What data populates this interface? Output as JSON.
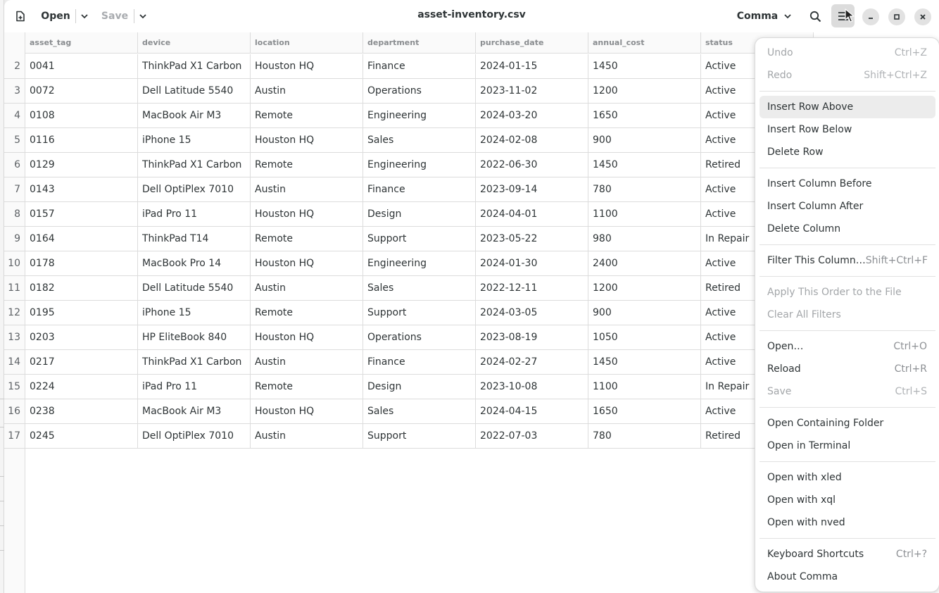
{
  "app": {
    "title": "asset-inventory.csv",
    "open_label": "Open",
    "save_label": "Save",
    "delimiter_label": "Comma"
  },
  "icons": {
    "new": "new-document-icon",
    "search": "search-icon",
    "menu": "hamburger-menu-icon",
    "minimize": "minimize-icon",
    "maximize": "maximize-icon",
    "close": "close-icon"
  },
  "table": {
    "columns": [
      "asset_tag",
      "device",
      "location",
      "department",
      "purchase_date",
      "annual_cost",
      "status"
    ],
    "rows": [
      {
        "num": "2",
        "cells": [
          "0041",
          "ThinkPad X1 Carbon",
          "Houston HQ",
          "Finance",
          "2024-01-15",
          "1450",
          "Active"
        ]
      },
      {
        "num": "3",
        "cells": [
          "0072",
          "Dell Latitude 5540",
          "Austin",
          "Operations",
          "2023-11-02",
          "1200",
          "Active"
        ]
      },
      {
        "num": "4",
        "cells": [
          "0108",
          "MacBook Air M3",
          "Remote",
          "Engineering",
          "2024-03-20",
          "1650",
          "Active"
        ]
      },
      {
        "num": "5",
        "cells": [
          "0116",
          "iPhone 15",
          "Houston HQ",
          "Sales",
          "2024-02-08",
          "900",
          "Active"
        ]
      },
      {
        "num": "6",
        "cells": [
          "0129",
          "ThinkPad X1 Carbon",
          "Remote",
          "Engineering",
          "2022-06-30",
          "1450",
          "Retired"
        ]
      },
      {
        "num": "7",
        "cells": [
          "0143",
          "Dell OptiPlex 7010",
          "Austin",
          "Finance",
          "2023-09-14",
          "780",
          "Active"
        ]
      },
      {
        "num": "8",
        "cells": [
          "0157",
          "iPad Pro 11",
          "Houston HQ",
          "Design",
          "2024-04-01",
          "1100",
          "Active"
        ]
      },
      {
        "num": "9",
        "cells": [
          "0164",
          "ThinkPad T14",
          "Remote",
          "Support",
          "2023-05-22",
          "980",
          "In Repair"
        ]
      },
      {
        "num": "10",
        "cells": [
          "0178",
          "MacBook Pro 14",
          "Houston HQ",
          "Engineering",
          "2024-01-30",
          "2400",
          "Active"
        ]
      },
      {
        "num": "11",
        "cells": [
          "0182",
          "Dell Latitude 5540",
          "Austin",
          "Sales",
          "2022-12-11",
          "1200",
          "Retired"
        ]
      },
      {
        "num": "12",
        "cells": [
          "0195",
          "iPhone 15",
          "Remote",
          "Support",
          "2024-03-05",
          "900",
          "Active"
        ]
      },
      {
        "num": "13",
        "cells": [
          "0203",
          "HP EliteBook 840",
          "Houston HQ",
          "Operations",
          "2023-08-19",
          "1050",
          "Active"
        ]
      },
      {
        "num": "14",
        "cells": [
          "0217",
          "ThinkPad X1 Carbon",
          "Austin",
          "Finance",
          "2024-02-27",
          "1450",
          "Active"
        ]
      },
      {
        "num": "15",
        "cells": [
          "0224",
          "iPad Pro 11",
          "Remote",
          "Design",
          "2023-10-08",
          "1100",
          "In Repair"
        ]
      },
      {
        "num": "16",
        "cells": [
          "0238",
          "MacBook Air M3",
          "Houston HQ",
          "Sales",
          "2024-04-15",
          "1650",
          "Active"
        ]
      },
      {
        "num": "17",
        "cells": [
          "0245",
          "Dell OptiPlex 7010",
          "Austin",
          "Support",
          "2022-07-03",
          "780",
          "Retired"
        ]
      }
    ]
  },
  "menu": {
    "groups": [
      [
        {
          "label": "Undo",
          "accel": "Ctrl+Z",
          "disabled": true
        },
        {
          "label": "Redo",
          "accel": "Shift+Ctrl+Z",
          "disabled": true
        }
      ],
      [
        {
          "label": "Insert Row Above",
          "accel": "",
          "highlighted": true
        },
        {
          "label": "Insert Row Below",
          "accel": ""
        },
        {
          "label": "Delete Row",
          "accel": ""
        }
      ],
      [
        {
          "label": "Insert Column Before",
          "accel": ""
        },
        {
          "label": "Insert Column After",
          "accel": ""
        },
        {
          "label": "Delete Column",
          "accel": ""
        }
      ],
      [
        {
          "label": "Filter This Column…",
          "accel": "Shift+Ctrl+F"
        }
      ],
      [
        {
          "label": "Apply This Order to the File",
          "accel": "",
          "disabled": true
        },
        {
          "label": "Clear All Filters",
          "accel": "",
          "disabled": true
        }
      ],
      [
        {
          "label": "Open…",
          "accel": "Ctrl+O"
        },
        {
          "label": "Reload",
          "accel": "Ctrl+R"
        },
        {
          "label": "Save",
          "accel": "Ctrl+S",
          "disabled": true
        }
      ],
      [
        {
          "label": "Open Containing Folder",
          "accel": ""
        },
        {
          "label": "Open in Terminal",
          "accel": ""
        }
      ],
      [
        {
          "label": "Open with xled",
          "accel": ""
        },
        {
          "label": "Open with xql",
          "accel": ""
        },
        {
          "label": "Open with nved",
          "accel": ""
        }
      ],
      [
        {
          "label": "Keyboard Shortcuts",
          "accel": "Ctrl+?"
        },
        {
          "label": "About Comma",
          "accel": ""
        }
      ]
    ]
  }
}
